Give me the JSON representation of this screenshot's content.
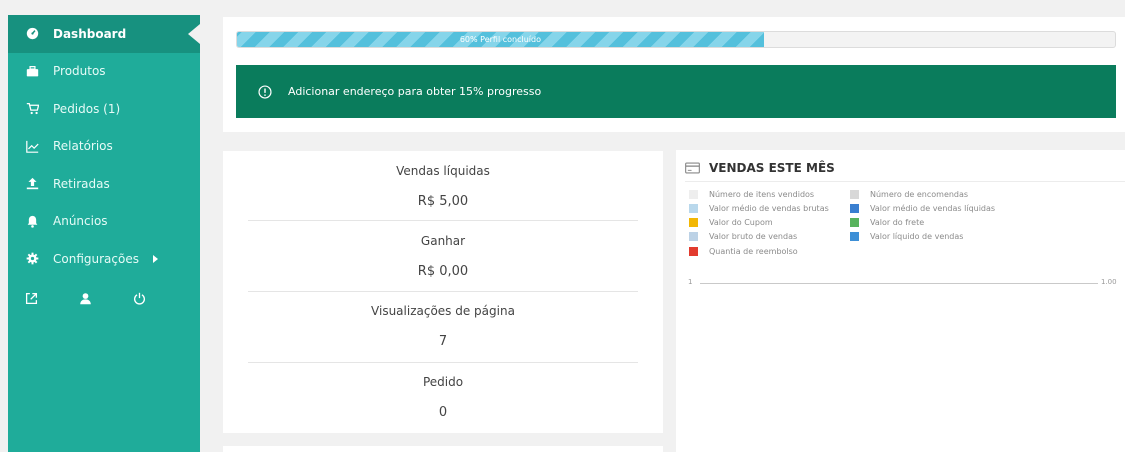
{
  "sidebar": {
    "items": [
      {
        "label": "Dashboard",
        "icon": "dashboard-icon",
        "active": true
      },
      {
        "label": "Produtos",
        "icon": "briefcase-icon"
      },
      {
        "label": "Pedidos (1)",
        "icon": "cart-icon"
      },
      {
        "label": "Relatórios",
        "icon": "line-chart-icon"
      },
      {
        "label": "Retiradas",
        "icon": "upload-icon"
      },
      {
        "label": "Anúncios",
        "icon": "bell-icon"
      },
      {
        "label": "Configurações",
        "icon": "gear-icon"
      }
    ],
    "tools": [
      "external-link-icon",
      "user-icon",
      "power-icon"
    ],
    "accent": "#1fac9a"
  },
  "profile": {
    "progress_percent": 60,
    "progress_label": "60% Perfil concluído",
    "alert_text": "Adicionar endereço  para obter 15% progresso",
    "alert_color": "#0a7c5c"
  },
  "stats": [
    {
      "label": "Vendas líquidas",
      "value": "R$ 5,00"
    },
    {
      "label": "Ganhar",
      "value": "R$ 0,00"
    },
    {
      "label": "Visualizações de página",
      "value": "7"
    },
    {
      "label": "Pedido",
      "value": "0"
    }
  ],
  "sales": {
    "title": "VENDAS ESTE MÊS",
    "legend": [
      {
        "label": "Número de itens vendidos",
        "color": "#eeeeee"
      },
      {
        "label": "Número de encomendas",
        "color": "#d8d8d8"
      },
      {
        "label": "Valor médio de vendas brutas",
        "color": "#b9d8ec"
      },
      {
        "label": "Valor médio de vendas líquidas",
        "color": "#3a7fd0"
      },
      {
        "label": "Valor do Cupom",
        "color": "#f2b705"
      },
      {
        "label": "Valor do frete",
        "color": "#58b35d"
      },
      {
        "label": "Valor bruto de vendas",
        "color": "#bcd2e6"
      },
      {
        "label": "Valor líquido de vendas",
        "color": "#3d8fd6"
      },
      {
        "label": "Quantia de reembolso",
        "color": "#e23b2e"
      }
    ],
    "axis_left": "1",
    "axis_right": "1.00"
  }
}
